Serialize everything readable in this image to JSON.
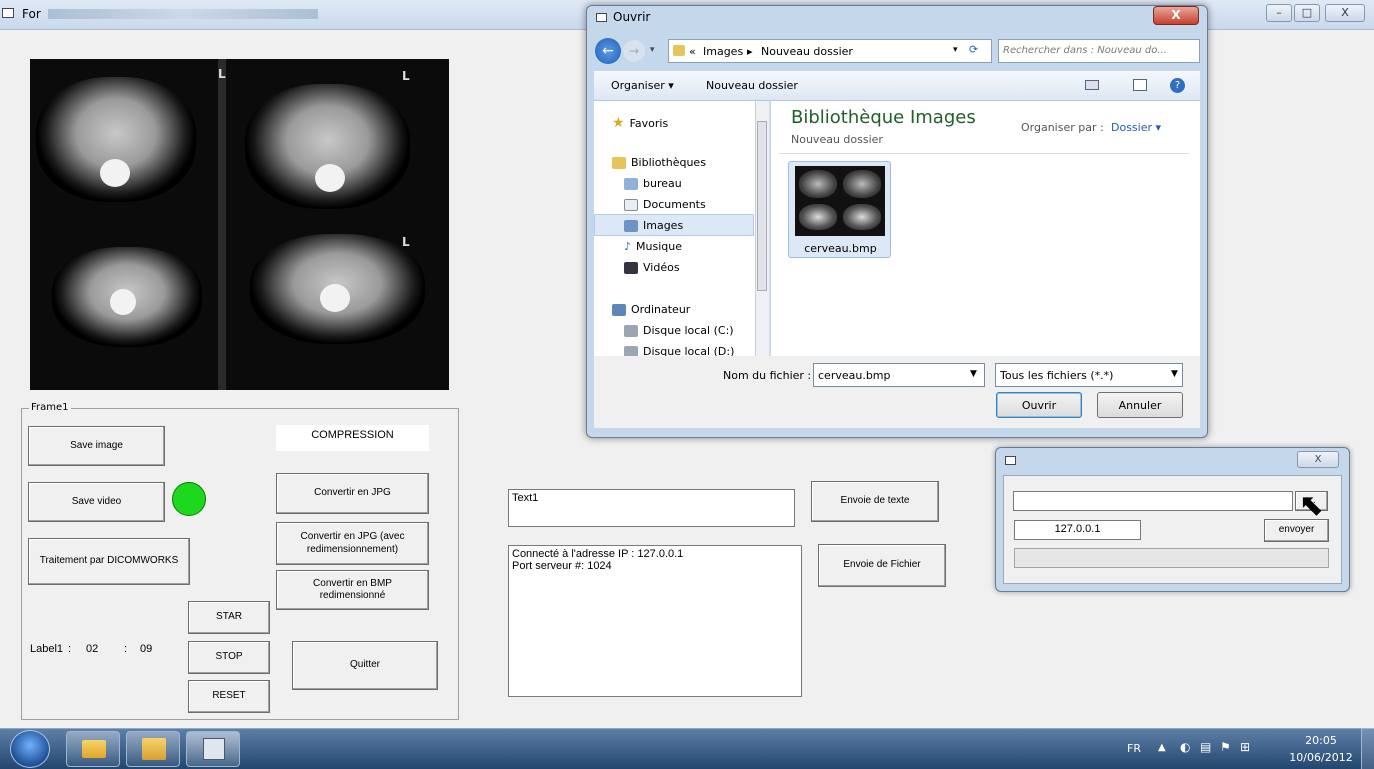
{
  "main_window": {
    "title": "For",
    "controls": {
      "minimize": "–",
      "maximize": "□",
      "close": "X"
    }
  },
  "image_panel": {
    "film_marks": [
      "L",
      "L",
      "L"
    ]
  },
  "frame1": {
    "label": "Frame1",
    "save_image": "Save image",
    "save_video": "Save video",
    "dicomworks": "Traitement par DICOMWORKS",
    "compression_label": "COMPRESSION",
    "convert_jpg": "Convertir en JPG",
    "convert_jpg_resize": "Convertir en JPG (avec redimensionnement)",
    "convert_bmp": "Convertir en BMP redimensionné",
    "star": "STAR",
    "stop": "STOP",
    "reset": "RESET",
    "quit": "Quitter",
    "timer_label": "Label1",
    "timer_sep1": ":",
    "timer_minutes": "02",
    "timer_sep2": ":",
    "timer_seconds": "09",
    "status_color": "#1ed81e"
  },
  "comm": {
    "text_field": "Text1",
    "send_text": "Envoie de texte",
    "log": "Connecté à l'adresse IP : 127.0.0.1\nPort serveur #: 1024",
    "send_file": "Envoie de Fichier"
  },
  "open_dialog": {
    "title": "Ouvrir",
    "close": "X",
    "path": [
      "«",
      "Images",
      "▸",
      "Nouveau dossier"
    ],
    "search_placeholder": "Rechercher dans : Nouveau do...",
    "organize": "Organiser ▾",
    "new_folder": "Nouveau dossier",
    "nav": {
      "favorites": "Favoris",
      "libraries": "Bibliothèques",
      "bureau": "bureau",
      "documents": "Documents",
      "images": "Images",
      "music": "Musique",
      "videos": "Vidéos",
      "computer": "Ordinateur",
      "disk_c": "Disque local (C:)",
      "disk_d": "Disque local (D:)"
    },
    "library_title": "Bibliothèque Images",
    "library_sub": "Nouveau dossier",
    "arrange_label": "Organiser par :",
    "arrange_value": "Dossier ▾",
    "file_name": "cerveau.bmp",
    "filename_label": "Nom du fichier :",
    "filename_value": "cerveau.bmp",
    "filter": "Tous les fichiers (*.*)",
    "open_btn": "Ouvrir",
    "cancel_btn": "Annuler"
  },
  "send_dialog": {
    "close": "X",
    "path_value": "",
    "browse": "...",
    "ip": "127.0.0.1",
    "send": "envoyer"
  },
  "taskbar": {
    "lang": "FR",
    "time": "20:05",
    "date": "10/06/2012",
    "tray": [
      "▲",
      "◐",
      "▤",
      "⚑",
      "⊞"
    ]
  }
}
